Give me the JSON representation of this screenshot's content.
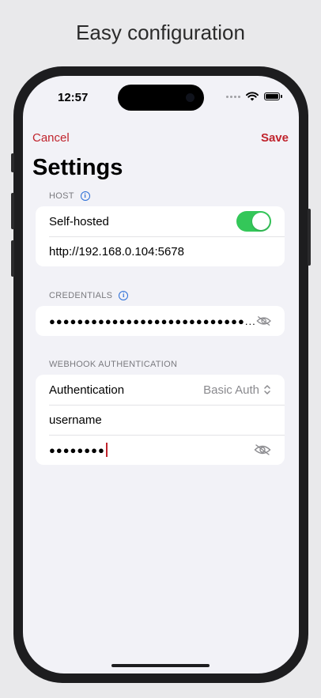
{
  "headline": "Easy configuration",
  "status_bar": {
    "time": "12:57",
    "icons": [
      "signal-dots-icon",
      "wifi-icon",
      "battery-icon"
    ]
  },
  "nav": {
    "cancel_label": "Cancel",
    "save_label": "Save"
  },
  "page_title": "Settings",
  "host": {
    "section_label": "HOST",
    "self_hosted_label": "Self-hosted",
    "self_hosted_enabled": true,
    "url_value": "http://192.168.0.104:5678"
  },
  "credentials": {
    "section_label": "CREDENTIALS",
    "masked_value": "●●●●●●●●●●●●●●●●●●●●●●●●●●●●..."
  },
  "webhook": {
    "section_label": "WEBHOOK AUTHENTICATION",
    "auth_label": "Authentication",
    "auth_value": "Basic Auth",
    "username_value": "username",
    "password_masked": "●●●●●●●●"
  },
  "colors": {
    "accent": "#c0232c",
    "toggle_on": "#34c759",
    "info": "#2b6ed6",
    "background": "#f2f2f7"
  }
}
